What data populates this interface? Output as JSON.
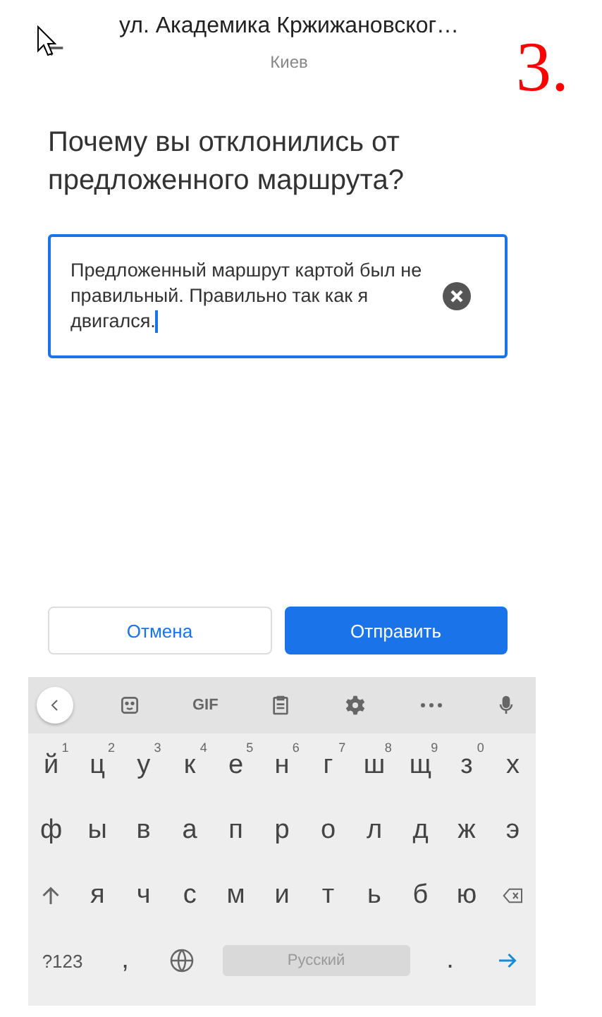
{
  "header": {
    "title": "ул. Академика Кржижановског…",
    "subtitle": "Киев"
  },
  "annotation": "3.",
  "question": "Почему вы отклонились от предложенного маршрута?",
  "answer": {
    "value": "Предложенный маршрут картой был не правильный. Правильно так как я двигался."
  },
  "buttons": [
    {
      "label": "Отмена",
      "kind": "secondary"
    },
    {
      "label": "Отправить",
      "kind": "primary"
    }
  ],
  "keyboard": {
    "toolbar": [
      {
        "kind": "back"
      },
      {
        "kind": "sticker"
      },
      {
        "kind": "gif",
        "label": "GIF"
      },
      {
        "kind": "clipboard"
      },
      {
        "kind": "settings"
      },
      {
        "kind": "more"
      },
      {
        "kind": "mic"
      }
    ],
    "rows": [
      [
        {
          "kind": "letter",
          "label": "й",
          "hint": "1"
        },
        {
          "kind": "letter",
          "label": "ц",
          "hint": "2"
        },
        {
          "kind": "letter",
          "label": "у",
          "hint": "3"
        },
        {
          "kind": "letter",
          "label": "к",
          "hint": "4"
        },
        {
          "kind": "letter",
          "label": "е",
          "hint": "5"
        },
        {
          "kind": "letter",
          "label": "н",
          "hint": "6"
        },
        {
          "kind": "letter",
          "label": "г",
          "hint": "7"
        },
        {
          "kind": "letter",
          "label": "ш",
          "hint": "8"
        },
        {
          "kind": "letter",
          "label": "щ",
          "hint": "9"
        },
        {
          "kind": "letter",
          "label": "з",
          "hint": "0"
        },
        {
          "kind": "letter",
          "label": "х"
        }
      ],
      [
        {
          "kind": "letter",
          "label": "ф"
        },
        {
          "kind": "letter",
          "label": "ы"
        },
        {
          "kind": "letter",
          "label": "в"
        },
        {
          "kind": "letter",
          "label": "а"
        },
        {
          "kind": "letter",
          "label": "п"
        },
        {
          "kind": "letter",
          "label": "р"
        },
        {
          "kind": "letter",
          "label": "о"
        },
        {
          "kind": "letter",
          "label": "л"
        },
        {
          "kind": "letter",
          "label": "д"
        },
        {
          "kind": "letter",
          "label": "ж"
        },
        {
          "kind": "letter",
          "label": "э"
        }
      ],
      [
        {
          "kind": "shift"
        },
        {
          "kind": "letter",
          "label": "я"
        },
        {
          "kind": "letter",
          "label": "ч"
        },
        {
          "kind": "letter",
          "label": "с"
        },
        {
          "kind": "letter",
          "label": "м"
        },
        {
          "kind": "letter",
          "label": "и"
        },
        {
          "kind": "letter",
          "label": "т"
        },
        {
          "kind": "letter",
          "label": "ь"
        },
        {
          "kind": "letter",
          "label": "б"
        },
        {
          "kind": "letter",
          "label": "ю"
        },
        {
          "kind": "backspace"
        }
      ]
    ],
    "bottom_row": [
      {
        "kind": "symbols",
        "label": "?123"
      },
      {
        "kind": "emoji",
        "label": ","
      },
      {
        "kind": "globe"
      },
      {
        "kind": "space",
        "label": "Русский"
      },
      {
        "kind": "letter",
        "label": "."
      },
      {
        "kind": "enter"
      }
    ]
  }
}
